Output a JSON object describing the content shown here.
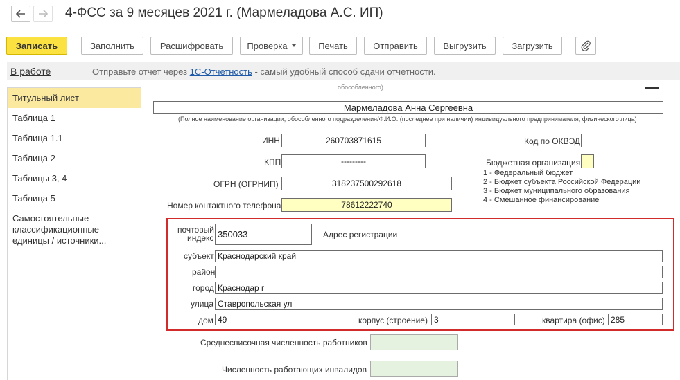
{
  "header": {
    "title": "4-ФСС за 9 месяцев 2021 г. (Мармеладова А.С. ИП)"
  },
  "toolbar": {
    "save": "Записать",
    "fill": "Заполнить",
    "decode": "Расшифровать",
    "check": "Проверка",
    "print": "Печать",
    "send": "Отправить",
    "export": "Выгрузить",
    "import": "Загрузить"
  },
  "infobar": {
    "status": "В работе",
    "hint_prefix": "Отправьте отчет через ",
    "hint_link": "1С-Отчетность",
    "hint_suffix": " - самый удобный способ сдачи отчетности."
  },
  "sidebar": {
    "items": [
      "Титульный лист",
      "Таблица 1",
      "Таблица 1.1",
      "Таблица 2",
      "Таблицы 3, 4",
      "Таблица 5",
      "Самостоятельные классификационные единицы / источники..."
    ]
  },
  "form": {
    "top_cut_label": "обособленного)",
    "org_name": "Мармеладова Анна Сергеевна",
    "org_name_caption": "(Полное наименование организации, обособленного подразделения/Ф.И.О. (последнее при наличии) индивидуального предпринимателя, физического лица)",
    "inn_label": "ИНН",
    "inn": "260703871615",
    "kpp_label": "КПП",
    "kpp": "---------",
    "ogrn_label": "ОГРН (ОГРНИП)",
    "ogrn": "318237500292618",
    "phone_label": "Номер контактного телефона",
    "phone": "78612222740",
    "okved_label": "Код по ОКВЭД",
    "okved": "",
    "budget_label": "Бюджетная организация",
    "budget_options": [
      "1 - Федеральный бюджет",
      "2 - Бюджет субъекта Российской Федерации",
      "3 - Бюджет муниципального образования",
      "4 - Смешанное финансирование"
    ],
    "address": {
      "index_label_1": "почтовый",
      "index_label_2": "индекс",
      "index": "350033",
      "title": "Адрес регистрации",
      "subject_label": "субъект",
      "subject": "Краснодарский край",
      "district_label": "район",
      "district": "",
      "city_label": "город",
      "city": "Краснодар г",
      "street_label": "улица",
      "street": "Ставропольская ул",
      "house_label": "дом",
      "house": "49",
      "building_label": "корпус (строение)",
      "building": "3",
      "flat_label": "квартира (офис)",
      "flat": "285"
    },
    "avg_workers_label": "Среднесписочная численность работников",
    "avg_workers": "",
    "disabled_label": "Численность работающих инвалидов",
    "disabled": ""
  },
  "colors": {
    "primary_button": "#fbe241",
    "active_item": "#fbe9a0",
    "highlight_frame": "#d12b2b",
    "link": "#1e5aa8"
  }
}
